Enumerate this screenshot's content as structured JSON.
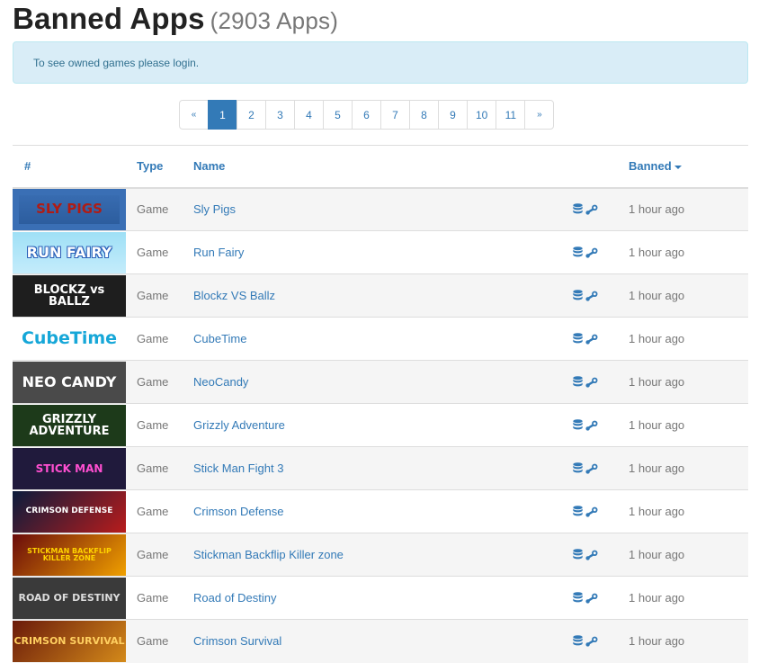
{
  "header": {
    "title": "Banned Apps",
    "count": "(2903 Apps)"
  },
  "alert": {
    "text": "To see owned games please login."
  },
  "pagination": {
    "prev": "«",
    "next": "»",
    "pages": [
      "1",
      "2",
      "3",
      "4",
      "5",
      "6",
      "7",
      "8",
      "9",
      "10",
      "11"
    ],
    "active": "1"
  },
  "table": {
    "headers": {
      "hash": "#",
      "type": "Type",
      "name": "Name",
      "banned": "Banned"
    },
    "rows": [
      {
        "thumb": "SLY PIGS",
        "type": "Game",
        "name": "Sly Pigs",
        "banned": "1 hour ago"
      },
      {
        "thumb": "RUN FAIRY",
        "type": "Game",
        "name": "Run Fairy",
        "banned": "1 hour ago"
      },
      {
        "thumb": "BLOCKZ vs BALLZ",
        "type": "Game",
        "name": "Blockz VS Ballz",
        "banned": "1 hour ago"
      },
      {
        "thumb": "CubeTime",
        "type": "Game",
        "name": "CubeTime",
        "banned": "1 hour ago"
      },
      {
        "thumb": "NEO CANDY",
        "type": "Game",
        "name": "NeoCandy",
        "banned": "1 hour ago"
      },
      {
        "thumb": "GRIZZLY ADVENTURE",
        "type": "Game",
        "name": "Grizzly Adventure",
        "banned": "1 hour ago"
      },
      {
        "thumb": "STICK MAN",
        "type": "Game",
        "name": "Stick Man Fight 3",
        "banned": "1 hour ago"
      },
      {
        "thumb": "CRIMSON DEFENSE",
        "type": "Game",
        "name": "Crimson Defense",
        "banned": "1 hour ago"
      },
      {
        "thumb": "STICKMAN BACKFLIP KILLER ZONE",
        "type": "Game",
        "name": "Stickman Backflip Killer zone",
        "banned": "1 hour ago"
      },
      {
        "thumb": "ROAD OF DESTINY",
        "type": "Game",
        "name": "Road of Destiny",
        "banned": "1 hour ago"
      },
      {
        "thumb": "CRIMSON SURVIVAL",
        "type": "Game",
        "name": "Crimson Survival",
        "banned": "1 hour ago"
      }
    ]
  },
  "icons": {
    "database": "database-icon",
    "steam": "steam-icon"
  },
  "colors": {
    "link": "#337ab7",
    "alert_bg": "#d9edf7",
    "alert_text": "#31708f",
    "stripe": "#f5f5f5"
  }
}
